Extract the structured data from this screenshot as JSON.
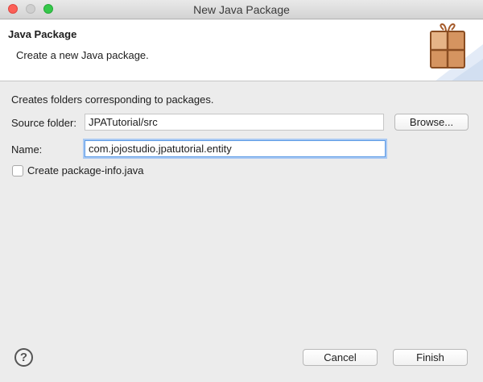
{
  "window": {
    "title": "New Java Package"
  },
  "banner": {
    "title": "Java Package",
    "description": "Create a new Java package.",
    "icon": "package-icon"
  },
  "form": {
    "intro": "Creates folders corresponding to packages.",
    "source_folder": {
      "label": "Source folder:",
      "value": "JPATutorial/src"
    },
    "name": {
      "label": "Name:",
      "value": "com.jojostudio.jpatutorial.entity"
    },
    "browse_label": "Browse...",
    "package_info": {
      "label": "Create package-info.java",
      "checked": false
    }
  },
  "footer": {
    "help_symbol": "?",
    "cancel_label": "Cancel",
    "finish_label": "Finish"
  }
}
